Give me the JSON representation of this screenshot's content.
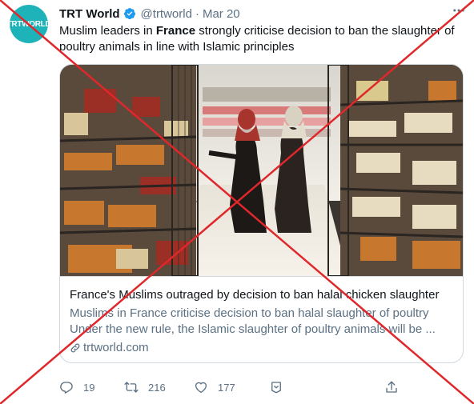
{
  "author": {
    "name": "TRT World",
    "handle": "@trtworld",
    "separator": "·",
    "date": "Mar 20",
    "avatar_text": "TRTWORLD"
  },
  "tweet": {
    "text_before": "Muslim leaders in ",
    "text_bold": "France",
    "text_after": " strongly criticise decision to ban the slaughter of poultry animals in line with Islamic principles"
  },
  "card": {
    "title": "France's Muslims outraged by decision to ban halal chicken slaughter",
    "description_line1": "Muslims in France criticise decision to ban halal slaughter of poultry",
    "description_line2": "Under the new rule, the Islamic slaughter of poultry animals will be ...",
    "domain": "trtworld.com"
  },
  "actions": {
    "reply_count": "19",
    "retweet_count": "216",
    "like_count": "177"
  },
  "icons": {
    "verified": "verified-badge-icon",
    "more": "more-options-icon",
    "reply": "reply-icon",
    "retweet": "retweet-icon",
    "like": "heart-icon",
    "bookmark": "bookmark-icon",
    "share": "share-icon",
    "link": "link-icon"
  },
  "colors": {
    "accent": "#1d9bf0",
    "secondary_text": "#5b7083",
    "overlay_cross": "#e0272b",
    "avatar": "#1db3b8"
  }
}
